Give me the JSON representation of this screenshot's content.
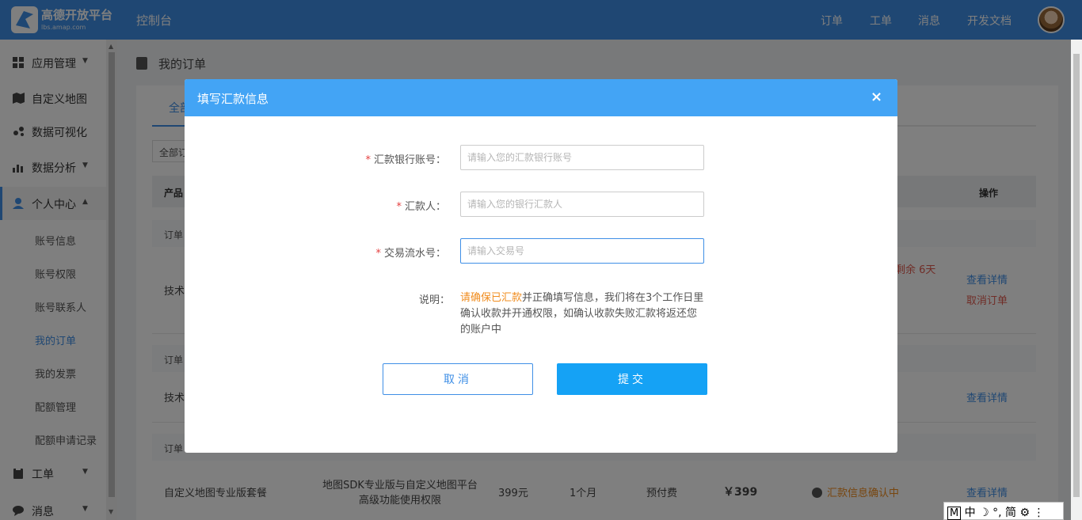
{
  "header": {
    "brand": "高德开放平台",
    "brand_sub": "lbs.amap.com",
    "console": "控制台",
    "nav": [
      "订单",
      "工单",
      "消息",
      "开发文档"
    ]
  },
  "sidebar": {
    "items": [
      {
        "label": "应用管理",
        "icon": "grid-icon"
      },
      {
        "label": "自定义地图",
        "icon": "map-icon"
      },
      {
        "label": "数据可视化",
        "icon": "visual-icon"
      },
      {
        "label": "数据分析",
        "icon": "bar-chart-icon"
      },
      {
        "label": "个人中心",
        "icon": "user-icon"
      },
      {
        "label": "工单",
        "icon": "clipboard-icon"
      },
      {
        "label": "消息",
        "icon": "chat-icon"
      }
    ],
    "sub_items": [
      "账号信息",
      "账号权限",
      "账号联系人",
      "我的订单",
      "我的发票",
      "配额管理",
      "配额申请记录"
    ],
    "arrow_down": "▼",
    "arrow_up": "▲"
  },
  "page": {
    "title": "我的订单",
    "tab_all": "全部",
    "filter": "全部订",
    "col_product": "产品",
    "col_action": "操作",
    "group_label": "订单",
    "row_tech": "技术",
    "remaining": "剩余 6天",
    "view_detail": "查看详情",
    "cancel_order": "取消订单",
    "last_row": {
      "name": "自定义地图专业版套餐",
      "desc_1": "地图SDK专业版与自定义地图平台",
      "desc_2": "高级功能使用权限",
      "price": "399元",
      "duration": "1个月",
      "pay": "预付费",
      "amount": "￥399",
      "status": "汇款信息确认中"
    }
  },
  "modal": {
    "title": "填写汇款信息",
    "close": "×",
    "required_mark": "*",
    "fields": [
      {
        "label": "汇款银行账号：",
        "placeholder": "请输入您的汇款银行账号",
        "value": ""
      },
      {
        "label": "汇款人：",
        "placeholder": "请输入您的银行汇款人",
        "value": ""
      },
      {
        "label": "交易流水号：",
        "placeholder": "请输入交易号",
        "value": ""
      }
    ],
    "note_label": "说明：",
    "note_highlight": "请确保已汇款",
    "note_text": "并正确填写信息，我们将在3个工作日里确认收款并开通权限，如确认收款失败汇款将返还您的账户中",
    "cancel": "取消",
    "submit": "提交"
  },
  "ime": {
    "mode": "M",
    "text": "中 ☽ °, 简 ⚙ ⋮"
  },
  "colors": {
    "primary": "#3f8fe6",
    "modal_header": "#43a4f5",
    "submit": "#15a2f5",
    "highlight": "#f08c1e",
    "danger": "#e05a4f"
  }
}
